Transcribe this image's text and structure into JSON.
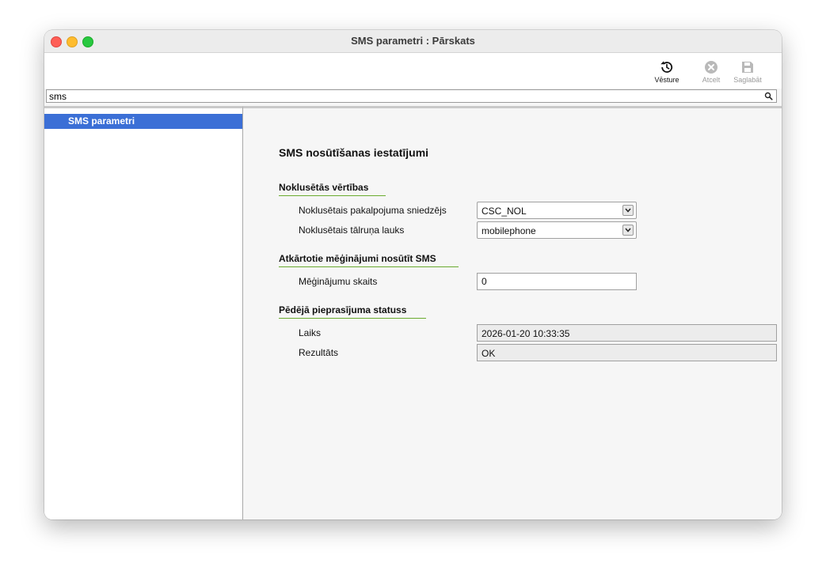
{
  "window": {
    "title": "SMS parametri : Pārskats"
  },
  "toolbar": {
    "history_label": "Vēsture",
    "cancel_label": "Atcelt",
    "save_label": "Saglabāt"
  },
  "search": {
    "value": "sms",
    "icon": "search-icon"
  },
  "sidebar": {
    "items": [
      {
        "label": "SMS parametri",
        "selected": true
      }
    ]
  },
  "main": {
    "heading": "SMS nosūtīšanas iestatījumi",
    "sections": {
      "defaults": {
        "title": "Noklusētās vērtības",
        "provider_label": "Noklusētais pakalpojuma sniedzējs",
        "provider_value": "CSC_NOL",
        "phone_field_label": "Noklusētais tālruņa lauks",
        "phone_field_value": "mobilephone"
      },
      "retries": {
        "title": "Atkārtotie mēģinājumi nosūtīt SMS",
        "count_label": "Mēģinājumu skaits",
        "count_value": "0"
      },
      "last_request": {
        "title": "Pēdējā pieprasījuma statuss",
        "time_label": "Laiks",
        "time_value": "2026-01-20 10:33:35",
        "result_label": "Rezultāts",
        "result_value": "OK"
      }
    }
  },
  "colors": {
    "selection": "#3b6fd6",
    "section_underline": "#6aab2f"
  }
}
